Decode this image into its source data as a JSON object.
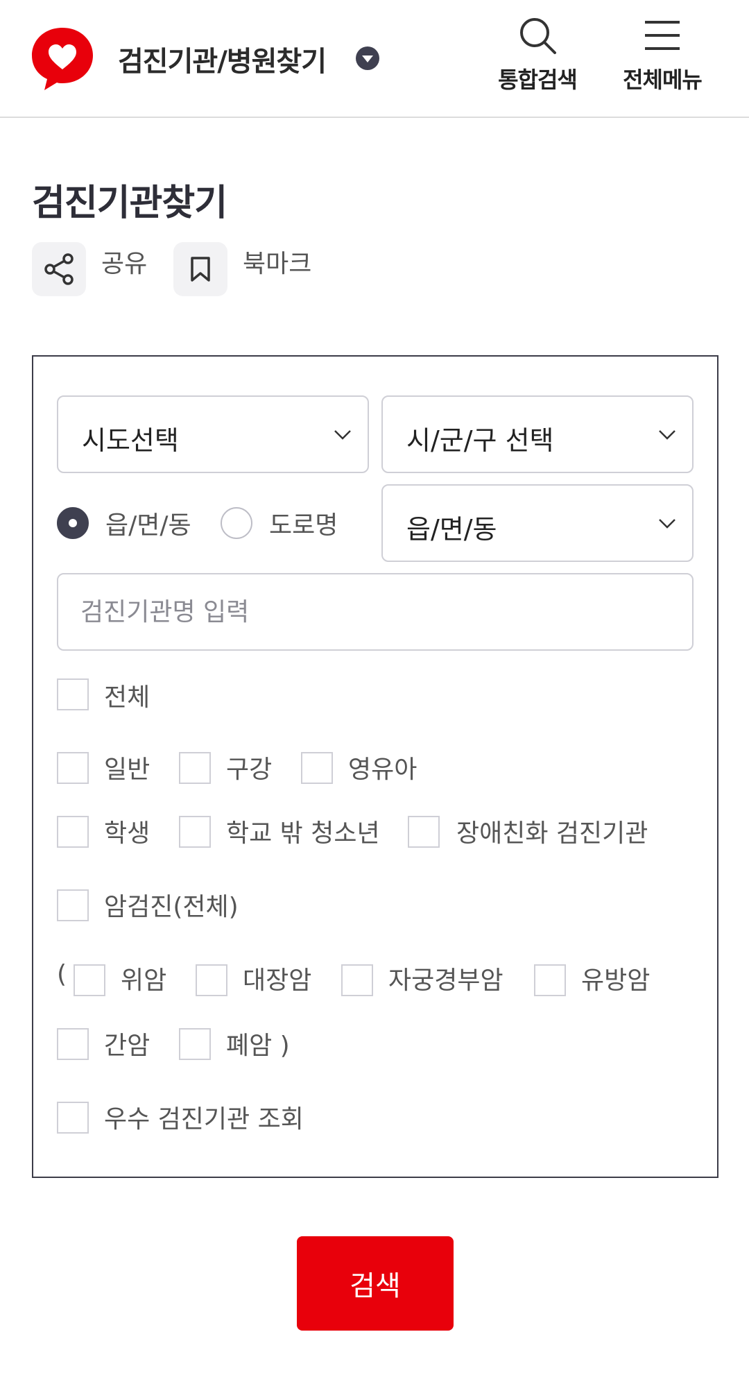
{
  "header": {
    "title": "검진기관/병원찾기",
    "search_label": "통합검색",
    "menu_label": "전체메뉴"
  },
  "page": {
    "title": "검진기관찾기",
    "share_label": "공유",
    "bookmark_label": "북마크"
  },
  "form": {
    "sido_select": "시도선택",
    "sigungu_select": "시/군/구 선택",
    "emd_select": "읍/면/동",
    "radio_emd": "읍/면/동",
    "radio_road": "도로명",
    "radio_selected": "읍/면/동",
    "name_placeholder": "검진기관명 입력",
    "checkbox_all": "전체",
    "checkbox_general": "일반",
    "checkbox_oral": "구강",
    "checkbox_infant": "영유아",
    "checkbox_student": "학생",
    "checkbox_out_of_school": "학교 밖 청소년",
    "checkbox_disability": "장애친화 검진기관",
    "checkbox_cancer_all": "암검진(전체)",
    "paren_open": "(",
    "checkbox_stomach": "위암",
    "checkbox_colon": "대장암",
    "checkbox_cervical": "자궁경부암",
    "checkbox_breast": "유방암",
    "checkbox_liver": "간암",
    "checkbox_lung": "폐암 )",
    "checkbox_excellent": "우수 검진기관 조회"
  },
  "search_button": "검색",
  "colors": {
    "brand_red": "#e8000b",
    "dark": "#3f4050"
  },
  "icons": [
    "heart-logo-icon",
    "caret-down-icon",
    "search-icon",
    "hamburger-menu-icon",
    "share-icon",
    "bookmark-icon",
    "chevron-down-icon"
  ]
}
